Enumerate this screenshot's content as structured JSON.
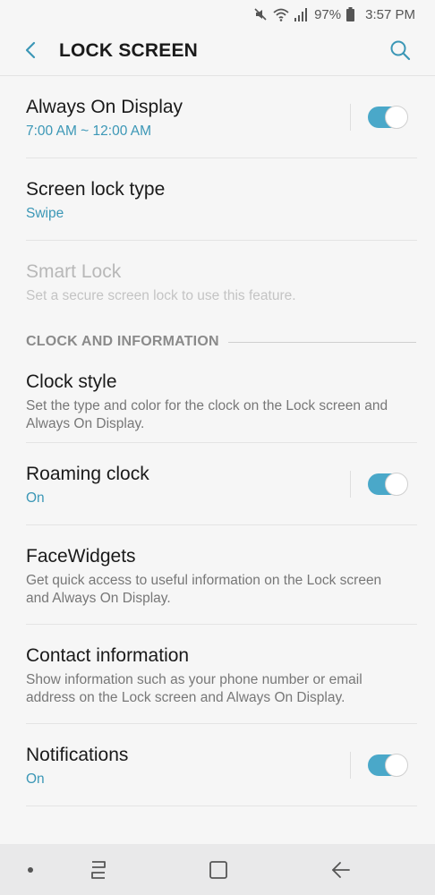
{
  "status_bar": {
    "icons": [
      "mute-icon",
      "wifi-icon",
      "signal-icon",
      "battery-icon"
    ],
    "battery_percent": "97%",
    "time": "3:57 PM"
  },
  "header": {
    "title": "LOCK SCREEN",
    "back_icon": "chevron-left-icon",
    "search_icon": "search-icon"
  },
  "settings": {
    "always_on_display": {
      "title": "Always On Display",
      "value": "7:00 AM ~ 12:00 AM",
      "toggle": "on"
    },
    "screen_lock_type": {
      "title": "Screen lock type",
      "value": "Swipe"
    },
    "smart_lock": {
      "title": "Smart Lock",
      "description": "Set a secure screen lock to use this feature.",
      "enabled": false
    },
    "section": {
      "label": "CLOCK AND INFORMATION"
    },
    "clock_style": {
      "title": "Clock style",
      "description": "Set the type and color for the clock on the Lock screen and Always On Display."
    },
    "roaming_clock": {
      "title": "Roaming clock",
      "value": "On",
      "toggle": "on"
    },
    "facewidgets": {
      "title": "FaceWidgets",
      "description": "Get quick access to useful information on the Lock screen and Always On Display."
    },
    "contact_information": {
      "title": "Contact information",
      "description": "Show information such as your phone number or email address on the Lock screen and Always On Display."
    },
    "notifications": {
      "title": "Notifications",
      "value": "On",
      "toggle": "on"
    }
  },
  "nav_bar": {
    "items": [
      "dot-icon",
      "recents-icon",
      "home-icon",
      "back-arrow-icon"
    ]
  },
  "colors": {
    "accent": "#3b97b6",
    "toggle_on": "#4aa8c9",
    "background": "#f6f6f6",
    "nav_background": "#e9e9ea"
  }
}
